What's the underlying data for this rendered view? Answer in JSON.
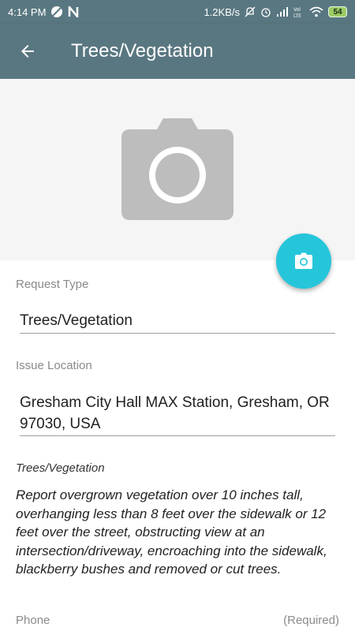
{
  "status_bar": {
    "time": "4:14 PM",
    "network_speed": "1.2KB/s",
    "battery": "54",
    "left_icons": [
      "circle-slash-icon",
      "n-notification-icon"
    ],
    "right_icons": [
      "mute-icon",
      "alarm-icon",
      "signal-icon",
      "volte-icon",
      "wifi-icon",
      "battery-icon"
    ]
  },
  "app_bar": {
    "title": "Trees/Vegetation",
    "back_icon": "arrow-back-icon"
  },
  "photo": {
    "placeholder_icon": "camera-icon",
    "fab_icon": "camera-icon",
    "fab_color": "#26c6da"
  },
  "form": {
    "request_type": {
      "label": "Request Type",
      "value": "Trees/Vegetation"
    },
    "issue_location": {
      "label": "Issue Location",
      "value": "Gresham City Hall MAX Station, Gresham, OR 97030, USA"
    },
    "description": {
      "title": "Trees/Vegetation",
      "text": "Report overgrown vegetation over 10 inches tall, overhanging less than 8 feet over the sidewalk or 12 feet over the street, obstructing view at an intersection/driveway, encroaching into the sidewalk, blackberry bushes and removed or cut trees."
    },
    "phone": {
      "label": "Phone",
      "required": "(Required)"
    }
  },
  "colors": {
    "primary": "#597781",
    "accent": "#26c6da",
    "photo_bg": "#f5f5f5"
  }
}
